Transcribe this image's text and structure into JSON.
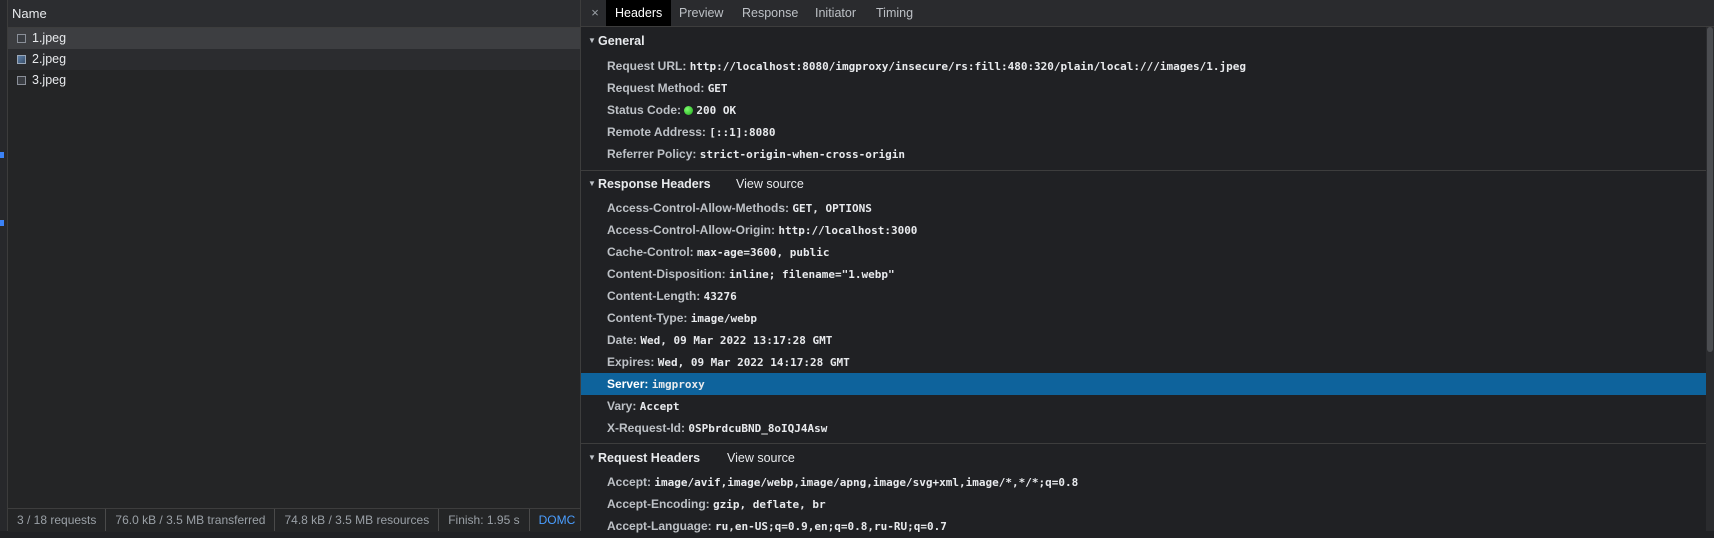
{
  "requests": {
    "column_name": "Name",
    "rows": [
      {
        "name": "1.jpeg",
        "selected": true
      },
      {
        "name": "2.jpeg",
        "selected": false
      },
      {
        "name": "3.jpeg",
        "selected": false
      }
    ]
  },
  "status_bar": {
    "requests": "3 / 18 requests",
    "transferred": "76.0 kB / 3.5 MB transferred",
    "resources": "74.8 kB / 3.5 MB resources",
    "finish": "Finish: 1.95 s",
    "dom": "DOMC"
  },
  "tabs": {
    "close": "×",
    "items": [
      "Headers",
      "Preview",
      "Response",
      "Initiator",
      "Timing"
    ],
    "active": "Headers"
  },
  "general": {
    "title": "General",
    "rows": [
      {
        "name": "Request URL:",
        "value": "http://localhost:8080/imgproxy/insecure/rs:fill:480:320/plain/local:///images/1.jpeg"
      },
      {
        "name": "Request Method:",
        "value": "GET"
      },
      {
        "name": "Status Code:",
        "value": "200 OK",
        "status_color": "#22c55e"
      },
      {
        "name": "Remote Address:",
        "value": "[::1]:8080"
      },
      {
        "name": "Referrer Policy:",
        "value": "strict-origin-when-cross-origin"
      }
    ]
  },
  "response_headers": {
    "title": "Response Headers",
    "view_source": "View source",
    "rows": [
      {
        "name": "Access-Control-Allow-Methods:",
        "value": "GET, OPTIONS"
      },
      {
        "name": "Access-Control-Allow-Origin:",
        "value": "http://localhost:3000"
      },
      {
        "name": "Cache-Control:",
        "value": "max-age=3600, public"
      },
      {
        "name": "Content-Disposition:",
        "value": "inline; filename=\"1.webp\""
      },
      {
        "name": "Content-Length:",
        "value": "43276"
      },
      {
        "name": "Content-Type:",
        "value": "image/webp"
      },
      {
        "name": "Date:",
        "value": "Wed, 09 Mar 2022 13:17:28 GMT"
      },
      {
        "name": "Expires:",
        "value": "Wed, 09 Mar 2022 14:17:28 GMT"
      },
      {
        "name": "Server:",
        "value": "imgproxy",
        "selected": true
      },
      {
        "name": "Vary:",
        "value": "Accept"
      },
      {
        "name": "X-Request-Id:",
        "value": "0SPbrdcuBND_8oIQJ4Asw"
      }
    ]
  },
  "request_headers": {
    "title": "Request Headers",
    "view_source": "View source",
    "rows": [
      {
        "name": "Accept:",
        "value": "image/avif,image/webp,image/apng,image/svg+xml,image/*,*/*;q=0.8"
      },
      {
        "name": "Accept-Encoding:",
        "value": "gzip, deflate, br"
      },
      {
        "name": "Accept-Language:",
        "value": "ru,en-US;q=0.9,en;q=0.8,ru-RU;q=0.7"
      }
    ]
  },
  "colors": {
    "accent": "#0e639c",
    "link": "#4a9eff",
    "status_ok": "#22c55e"
  }
}
